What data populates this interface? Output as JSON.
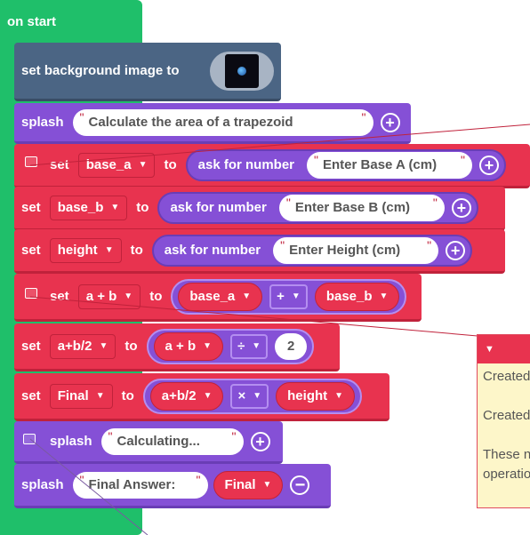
{
  "hat": {
    "label": "on start"
  },
  "bg_block": {
    "label": "set background image to"
  },
  "splash1": {
    "kw": "splash",
    "text": "Calculate the area of a trapezoid"
  },
  "set_a": {
    "kw_set": "set",
    "var": "base_a",
    "kw_to": "to",
    "ask": "ask for number",
    "prompt": "Enter Base A (cm)"
  },
  "set_b": {
    "kw_set": "set",
    "var": "base_b",
    "kw_to": "to",
    "ask": "ask for number",
    "prompt": "Enter Base B (cm)"
  },
  "set_h": {
    "kw_set": "set",
    "var": "height",
    "kw_to": "to",
    "ask": "ask for number",
    "prompt": "Enter Height (cm)"
  },
  "set_ab": {
    "kw_set": "set",
    "var": "a + b",
    "kw_to": "to",
    "left": "base_a",
    "op": "+",
    "right": "base_b"
  },
  "set_ab2": {
    "kw_set": "set",
    "var": "a+b/2",
    "kw_to": "to",
    "left": "a + b",
    "op": "÷",
    "right": "2"
  },
  "set_final": {
    "kw_set": "set",
    "var": "Final",
    "kw_to": "to",
    "left": "a+b/2",
    "op": "×",
    "right": "height"
  },
  "splash2": {
    "kw": "splash",
    "text": "Calculating..."
  },
  "splash3": {
    "kw": "splash",
    "text": "Final Answer:",
    "var": "Final"
  },
  "comment_panel": {
    "lines": [
      "Created",
      "Created",
      "These n",
      "operatio"
    ]
  },
  "icons": {
    "quote_open": "\"",
    "quote_close": "\"",
    "dropdown": "▼",
    "plus": "+",
    "minus": "−"
  }
}
